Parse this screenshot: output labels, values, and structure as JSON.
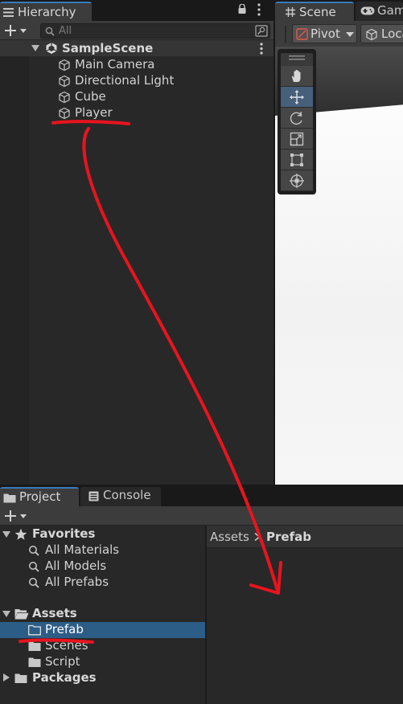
{
  "hierarchy": {
    "tab_label": "Hierarchy",
    "search_placeholder": "All",
    "scene_name": "SampleScene",
    "objects": [
      "Main Camera",
      "Directional Light",
      "Cube",
      "Player"
    ]
  },
  "scene_view": {
    "scene_tab_label": "Scene",
    "game_tab_label": "Game",
    "pivot_label": "Pivot",
    "local_label": "Local",
    "tools": [
      "hand-tool",
      "move-tool",
      "rotate-tool",
      "scale-tool",
      "rect-tool",
      "transform-tool"
    ],
    "active_tool": "move-tool"
  },
  "project": {
    "project_tab_label": "Project",
    "console_tab_label": "Console",
    "favorites_label": "Favorites",
    "favorites": [
      "All Materials",
      "All Models",
      "All Prefabs"
    ],
    "assets_label": "Assets",
    "asset_folders": [
      "Prefab",
      "Scenes",
      "Script"
    ],
    "selected_folder": "Prefab",
    "packages_label": "Packages",
    "breadcrumb": {
      "root": "Assets",
      "current": "Prefab"
    }
  },
  "colors": {
    "accent": "#3a79bb",
    "selection": "#2c5d87",
    "annotation": "#e8141e"
  }
}
